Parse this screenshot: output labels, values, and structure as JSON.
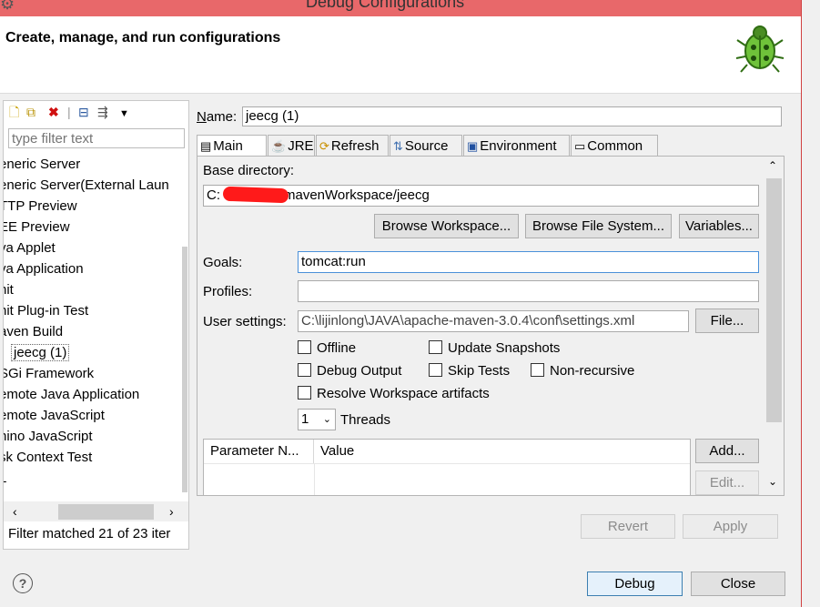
{
  "window": {
    "title": "Debug Configurations"
  },
  "banner": {
    "heading": "Create, manage, and run configurations",
    "icon": "bug-icon"
  },
  "left": {
    "toolbar": [
      "new-config-icon",
      "duplicate-icon",
      "delete-icon",
      "collapse-all-icon",
      "filter-icon",
      "view-menu-icon"
    ],
    "filter_placeholder": "type filter text",
    "items": [
      {
        "label": "eneric Server"
      },
      {
        "label": "eneric Server(External Laun"
      },
      {
        "label": "TTP Preview"
      },
      {
        "label": "EE Preview"
      },
      {
        "label": "va Applet"
      },
      {
        "label": "va Application"
      },
      {
        "label": "nit"
      },
      {
        "label": "nit Plug-in Test"
      },
      {
        "label": "aven Build"
      },
      {
        "label": "jeecg (1)",
        "selected": true
      },
      {
        "label": "SGi Framework"
      },
      {
        "label": "emote Java Application"
      },
      {
        "label": "emote JavaScript"
      },
      {
        "label": "hino JavaScript"
      },
      {
        "label": "sk Context Test"
      },
      {
        "label": "L"
      }
    ],
    "status": "Filter matched 21 of 23 iter"
  },
  "config": {
    "name_label": "Name:",
    "name_value": "jeecg (1)",
    "tabs": [
      {
        "label": "Main",
        "icon": "main-tab-icon",
        "active": true
      },
      {
        "label": "JRE",
        "icon": "jre-tab-icon"
      },
      {
        "label": "Refresh",
        "icon": "refresh-tab-icon"
      },
      {
        "label": "Source",
        "icon": "source-tab-icon"
      },
      {
        "label": "Environment",
        "icon": "environment-tab-icon"
      },
      {
        "label": "Common",
        "icon": "common-tab-icon"
      }
    ],
    "base_dir_label": "Base directory:",
    "base_dir_value": "C:\\              mavenWorkspace/jeecg",
    "base_dir_prefix": "C:",
    "base_dir_suffix": "mavenWorkspace/jeecg",
    "buttons": {
      "browse_workspace": "Browse Workspace...",
      "browse_fs": "Browse File System...",
      "variables": "Variables...",
      "file": "File...",
      "add": "Add...",
      "edit": "Edit..."
    },
    "goals_label": "Goals:",
    "goals_value": "tomcat:run",
    "profiles_label": "Profiles:",
    "profiles_value": "",
    "user_settings_label": "User settings:",
    "user_settings_value": "C:\\lijinlong\\JAVA\\apache-maven-3.0.4\\conf\\settings.xml",
    "checkboxes": {
      "offline": {
        "label": "Offline",
        "checked": false
      },
      "update_snapshots": {
        "label": "Update Snapshots",
        "checked": false
      },
      "debug_output": {
        "label": "Debug Output",
        "checked": false
      },
      "skip_tests": {
        "label": "Skip Tests",
        "checked": false
      },
      "non_recursive": {
        "label": "Non-recursive",
        "checked": false
      },
      "resolve_workspace": {
        "label": "Resolve Workspace artifacts",
        "checked": false
      }
    },
    "threads_value": "1",
    "threads_label": "Threads",
    "param_headers": [
      "Parameter N...",
      "Value"
    ]
  },
  "footer": {
    "revert": "Revert",
    "apply": "Apply",
    "debug": "Debug",
    "close": "Close",
    "help_icon": "help-icon"
  },
  "colors": {
    "titlebar": "#e8686a",
    "scribble": "#ff1a1a"
  }
}
